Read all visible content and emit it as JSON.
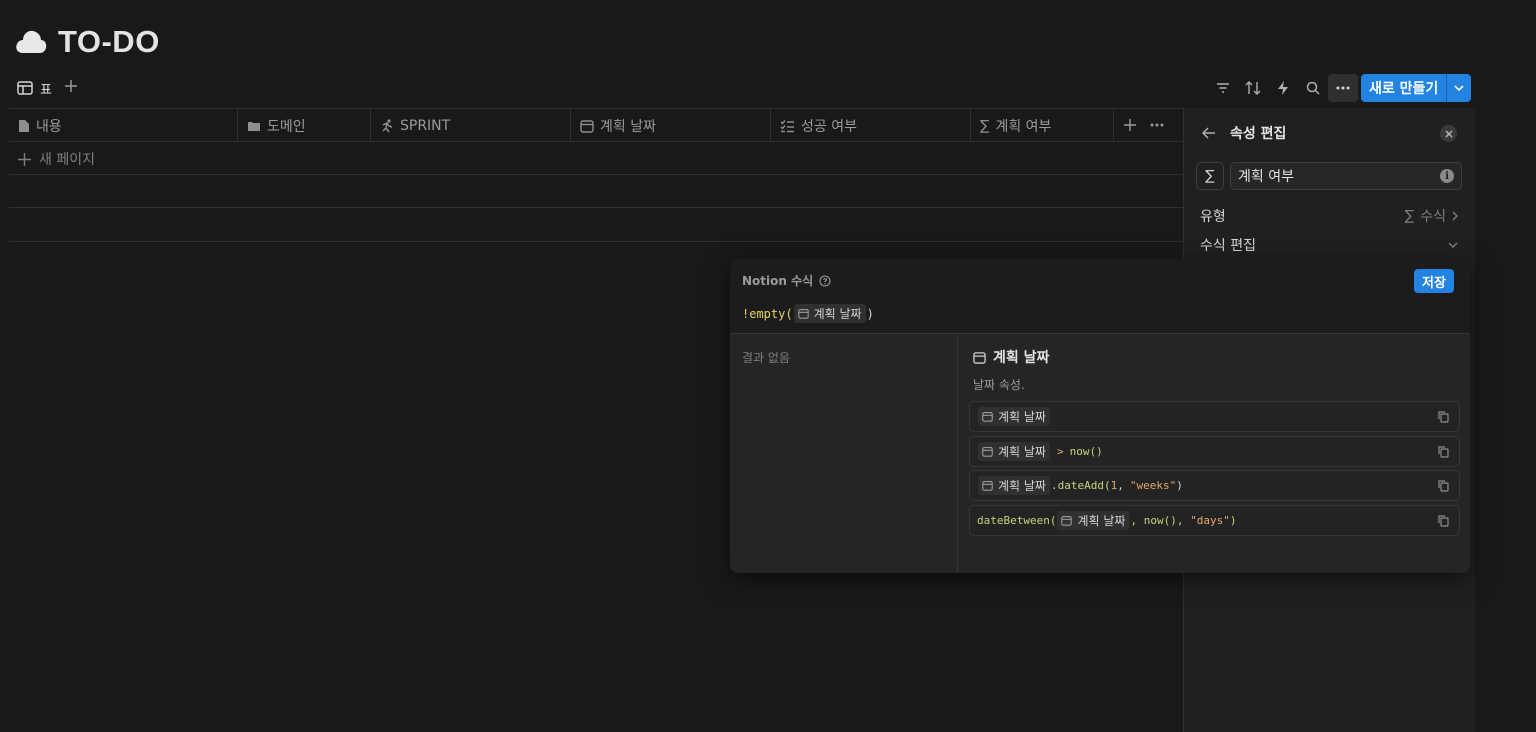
{
  "page": {
    "title": "TO-DO",
    "icon": "cloud-icon"
  },
  "view": {
    "tab_label": "표",
    "tab_icon": "table-icon"
  },
  "toolbar": {
    "icons": [
      "filter-icon",
      "sort-icon",
      "automation-icon",
      "search-icon",
      "more-icon"
    ],
    "new_button_label": "새로 만들기"
  },
  "table": {
    "columns": [
      {
        "label": "내용",
        "icon": "page-icon"
      },
      {
        "label": "도메인",
        "icon": "folder-icon"
      },
      {
        "label": "SPRINT",
        "icon": "runner-icon"
      },
      {
        "label": "계획 날짜",
        "icon": "calendar-icon"
      },
      {
        "label": "성공 여부",
        "icon": "checklist-icon"
      },
      {
        "label": "계획 여부",
        "icon": "sigma-icon"
      }
    ],
    "new_page_label": "새 페이지"
  },
  "panel": {
    "title": "속성 편집",
    "property_name": "계획 여부",
    "type_label": "유형",
    "type_value": "수식",
    "edit_formula_label": "수식 편집"
  },
  "editor": {
    "label": "Notion 수식",
    "save_label": "저장",
    "formula": {
      "prefix": "!empty(",
      "prop": "계획 날짜",
      "suffix": ")"
    },
    "no_result": "결과 없음",
    "doc": {
      "title": "계획 날짜",
      "subtitle": "날짜 속성.",
      "examples": [
        {
          "prop": "계획 날짜",
          "rest": ""
        },
        {
          "prop": "계획 날짜",
          "op": ">",
          "rest": "now()"
        },
        {
          "prop": "계획 날짜",
          "op": ".dateAdd(",
          "num": "1",
          "str": "\"weeks\"",
          "close": ")"
        },
        {
          "pre": "dateBetween(",
          "prop": "계획 날짜",
          "rest": ", now(), ",
          "str": "\"days\"",
          "close": ")"
        }
      ]
    }
  }
}
